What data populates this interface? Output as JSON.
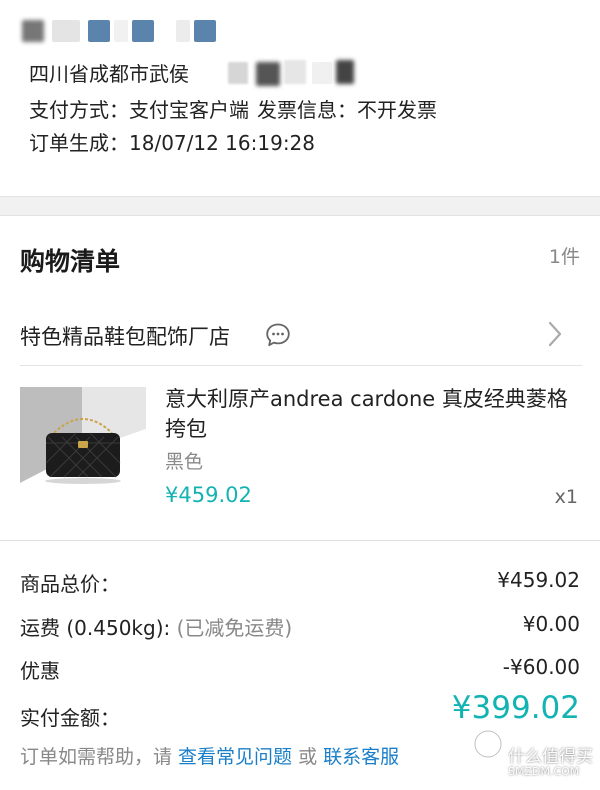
{
  "order": {
    "address": "四川省成都市武侯",
    "payment_label": "支付方式：",
    "payment_value": "支付宝客户端",
    "invoice_label": "发票信息：",
    "invoice_value": "不开发票",
    "created_label": "订单生成：",
    "created_value": "18/07/12 16:19:28"
  },
  "cart": {
    "title": "购物清单",
    "count": "1件",
    "store_name": "特色精品鞋包配饰厂店",
    "chat_icon": "chat-bubble-icon",
    "chevron_icon": "chevron-right-icon"
  },
  "product": {
    "title": "意大利原产andrea cardone 真皮经典菱格挎包",
    "variant": "黑色",
    "price": "¥459.02",
    "quantity": "x1"
  },
  "summary": {
    "subtotal_label": "商品总价：",
    "subtotal_value": "¥459.02",
    "shipping_label": "运费 (0.450kg):",
    "shipping_note": "(已减免运费)",
    "shipping_value": "¥0.00",
    "discount_label": "优惠",
    "discount_value": "-¥60.00",
    "total_label": "实付金额：",
    "total_value": "¥399.02"
  },
  "help": {
    "prefix": "订单如需帮助，请 ",
    "faq_link": "查看常见问题",
    "middle": " 或 ",
    "contact_link": "联系客服"
  },
  "watermark": {
    "line1": "什么值得买",
    "line2": "SMZDM.COM"
  },
  "colors": {
    "accent": "#14b3b3",
    "link": "#1a7fc8",
    "redaction_blue": "#5b84ac"
  }
}
